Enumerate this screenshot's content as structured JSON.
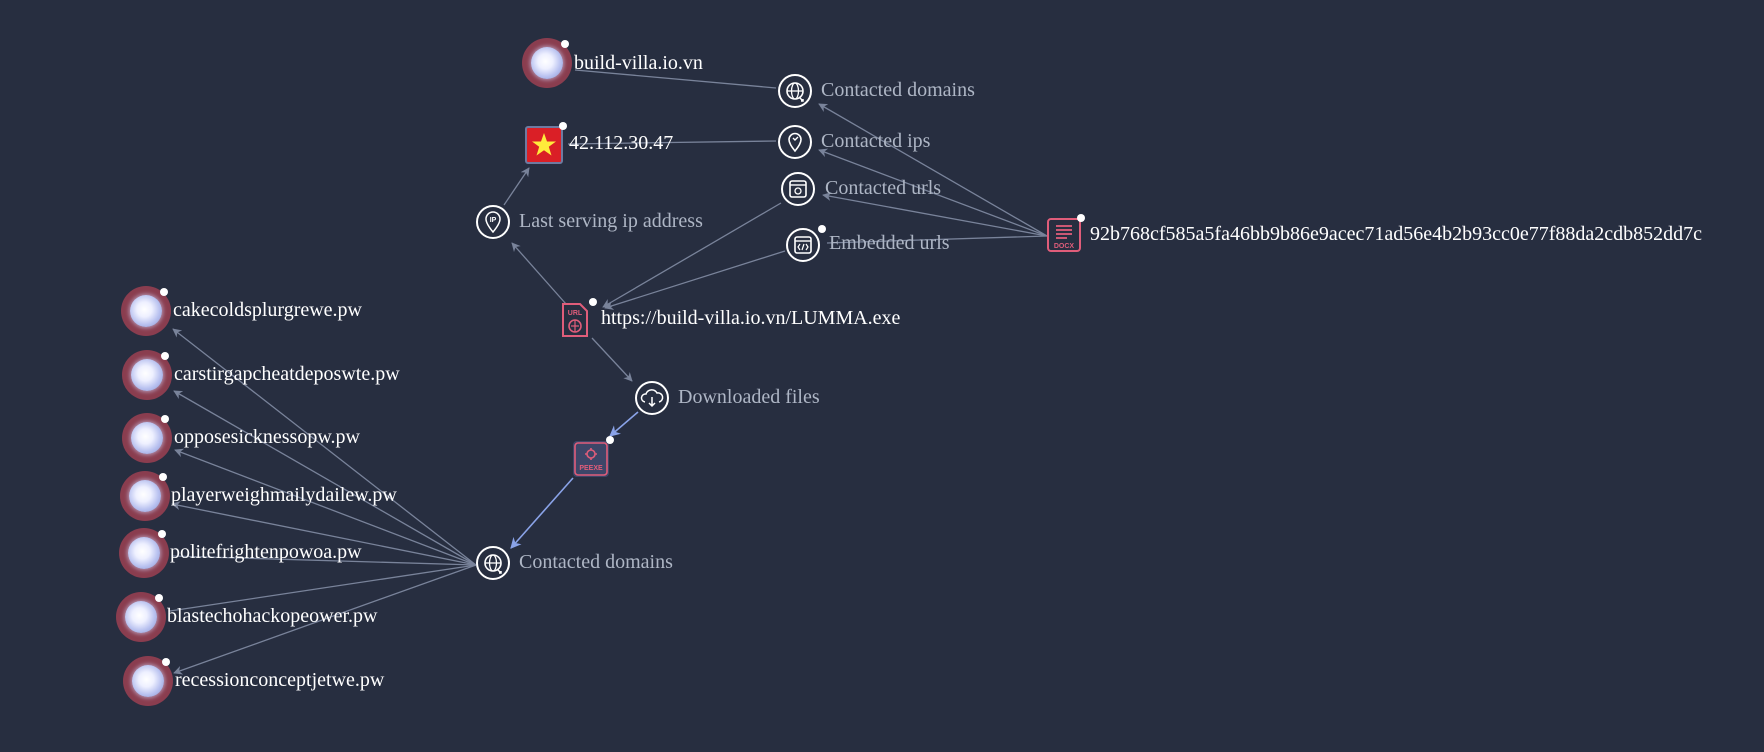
{
  "colors": {
    "background": "#272e40",
    "edge": "#79839a",
    "edge_highlight": "#8aa3e8",
    "domain_ring": "#8a3d4f",
    "file_accent": "#e05d7a",
    "flag_red": "#da1f26",
    "flag_star": "#ffeb3b",
    "relationship_text": "#aeb6c5",
    "node_text": "#ffffff"
  },
  "nodes": {
    "build_villa_domain": {
      "label": "build-villa.io.vn",
      "icon": "globe-icon"
    },
    "ip_address": {
      "label": "42.112.30.47",
      "icon": "vietnam-flag-icon"
    },
    "url_node": {
      "label": "https://build-villa.io.vn/LUMMA.exe",
      "icon": "url-file-icon",
      "badge": "URL"
    },
    "docx_file": {
      "label": "92b768cf585a5fa46bb9b86e9acec71ad56e4b2b93cc0e77f88da2cdb852dd7c",
      "icon": "docx-file-icon",
      "badge": "DOCX"
    },
    "peexe_file": {
      "icon": "peexe-file-icon",
      "badge": "PEEXE"
    }
  },
  "relationships": {
    "contacted_domains_top": {
      "label": "Contacted domains",
      "icon": "contacted-domains-icon"
    },
    "contacted_ips": {
      "label": "Contacted ips",
      "icon": "location-pin-icon"
    },
    "contacted_urls": {
      "label": "Contacted urls",
      "icon": "browser-link-icon"
    },
    "embedded_urls": {
      "label": "Embedded urls",
      "icon": "embedded-code-icon"
    },
    "last_serving_ip": {
      "label": "Last serving ip address",
      "icon": "ip-icon"
    },
    "downloaded_files": {
      "label": "Downloaded files",
      "icon": "cloud-download-icon"
    },
    "contacted_domains_bottom": {
      "label": "Contacted domains",
      "icon": "contacted-domains-icon"
    }
  },
  "domains": [
    "cakecoldsplurgrewe.pw",
    "carstirgapcheatdeposwte.pw",
    "opposesicknessopw.pw",
    "playerweighmailydailew.pw",
    "politefrightenpowoa.pw",
    "blastechohackopeower.pw",
    "recessionconceptjetwe.pw"
  ]
}
